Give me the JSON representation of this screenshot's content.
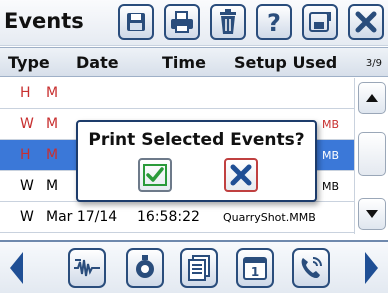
{
  "header": {
    "title": "Events"
  },
  "toolbar_icons": [
    "save-icon",
    "print-icon",
    "trash-icon",
    "help-icon",
    "export-icon",
    "close-icon"
  ],
  "columns": {
    "type": "Type",
    "date": "Date",
    "time": "Time",
    "setup": "Setup Used",
    "page": "3/9"
  },
  "rows": [
    {
      "type": "H",
      "date": "M",
      "time": "",
      "setup": "",
      "state": "red"
    },
    {
      "type": "W",
      "date": "M",
      "time": "",
      "setup": "MB",
      "state": "red"
    },
    {
      "type": "H",
      "date": "M",
      "time": "",
      "setup": "MB",
      "state": "selected"
    },
    {
      "type": "W",
      "date": "M",
      "time": "",
      "setup": "MB",
      "state": "normal"
    },
    {
      "type": "W",
      "date": "Mar 17/14",
      "time": "16:58:22",
      "setup": "QuarryShot.MMB",
      "state": "normal"
    }
  ],
  "dialog": {
    "message": "Print Selected Events?",
    "confirm_icon": "check-icon",
    "cancel_icon": "x-icon"
  },
  "bottom_icons": [
    "waveform-icon",
    "settings-icon",
    "documents-icon",
    "calendar-icon",
    "phone-icon"
  ],
  "colors": {
    "accent": "#2a4d7c",
    "selected_row": "#3b78d8",
    "red_text": "#c83030",
    "confirm": "#2a9a3a",
    "cancel": "#1f4f95"
  }
}
